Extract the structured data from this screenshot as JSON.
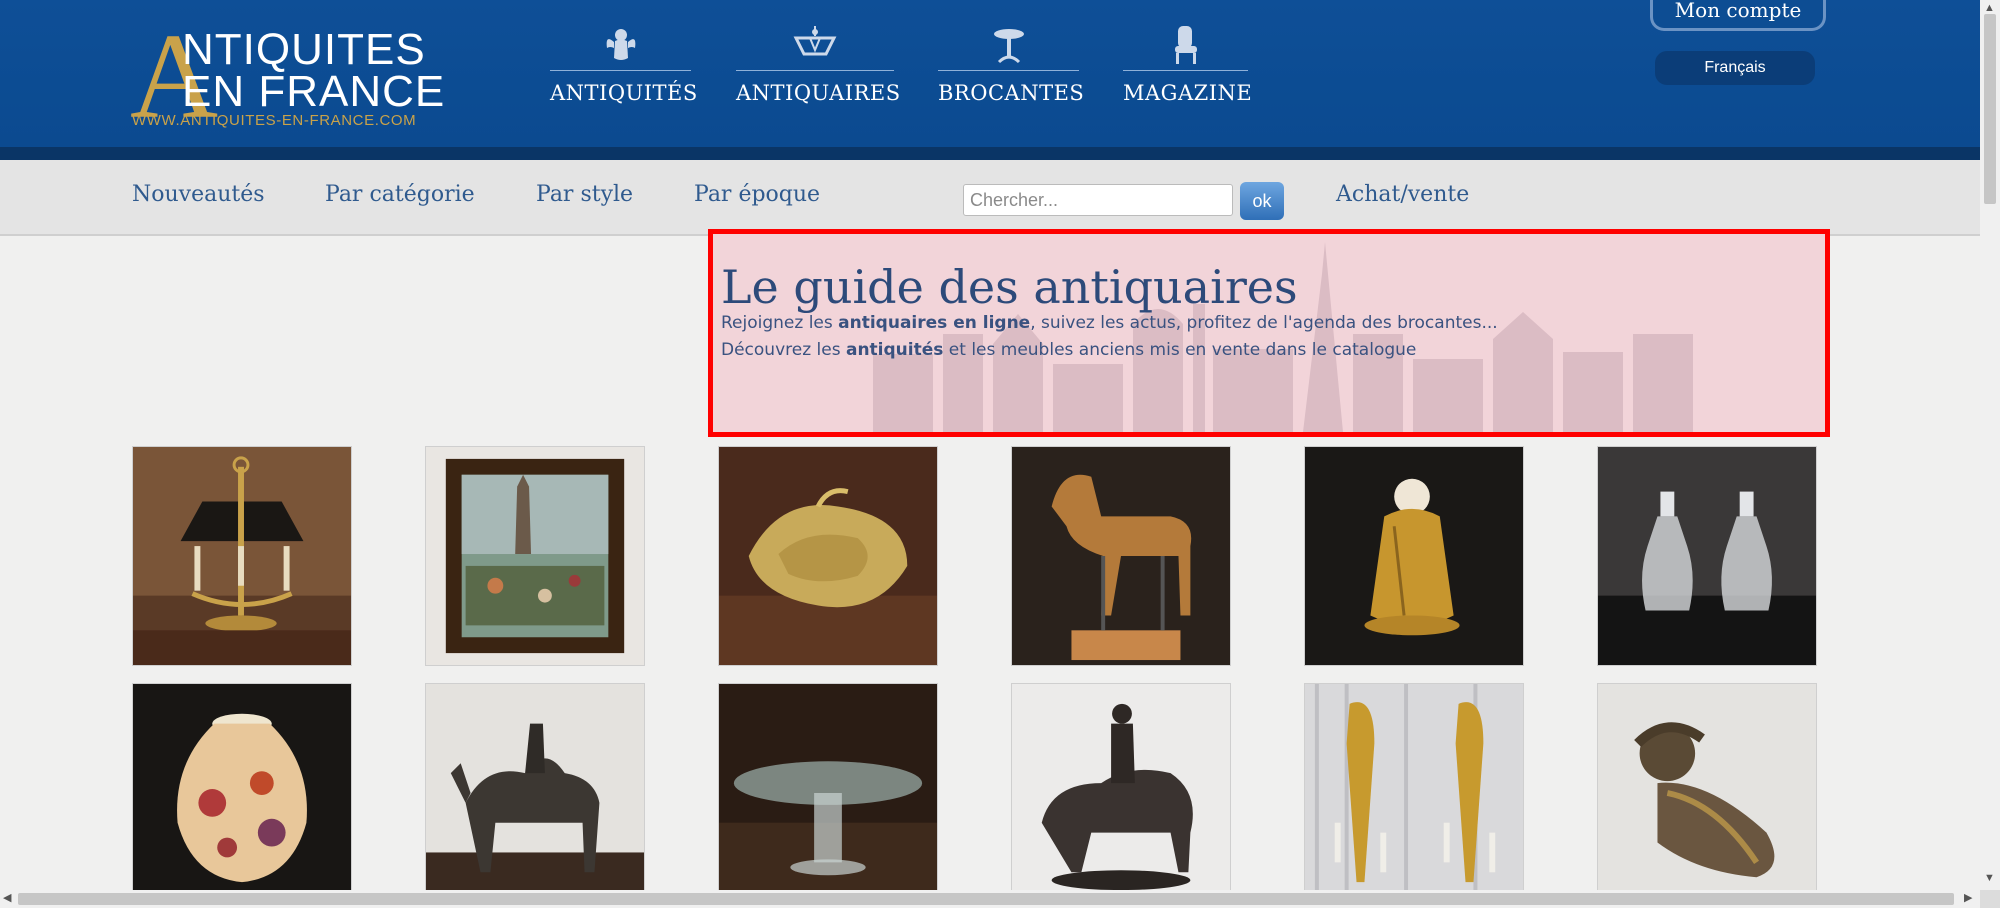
{
  "header": {
    "logo": {
      "big_letter": "A",
      "line1": "NTIQUITES",
      "line2": "EN FRANCE",
      "url": "WWW.ANTIQUITES-EN-FRANCE.COM"
    },
    "nav": [
      {
        "label": "ANTIQUITÉS",
        "icon": "cherub-icon"
      },
      {
        "label": "ANTIQUAIRES",
        "icon": "chandelier-icon"
      },
      {
        "label": "BROCANTES",
        "icon": "table-icon"
      },
      {
        "label": "MAGAZINE",
        "icon": "chair-icon"
      }
    ],
    "account_label": "Mon compte",
    "language": "Français"
  },
  "subnav": {
    "items": [
      "Nouveautés",
      "Par catégorie",
      "Par style",
      "Par époque"
    ],
    "search_placeholder": "Chercher...",
    "search_button": "ok",
    "achat_vente": "Achat/vente"
  },
  "banner": {
    "title": "Le guide des antiquaires",
    "line1_pre": "Rejoignez les ",
    "line1_bold": "antiquaires en ligne",
    "line1_post": ", suivez les actus, profitez de l'agenda des brocantes...",
    "line2_pre": "Découvrez les ",
    "line2_bold": "antiquités",
    "line2_post": " et les meubles anciens mis en vente dans le catalogue"
  },
  "products": [
    {
      "name": "bouillotte-lamp-image"
    },
    {
      "name": "market-painting-image"
    },
    {
      "name": "gilt-bronze-dish-image"
    },
    {
      "name": "wooden-horse-model-image"
    },
    {
      "name": "gilt-figure-image"
    },
    {
      "name": "glass-decanters-image"
    },
    {
      "name": "floral-vase-image"
    },
    {
      "name": "camel-rider-bronze-image"
    },
    {
      "name": "glass-table-image"
    },
    {
      "name": "horseman-bronze-image"
    },
    {
      "name": "wall-sconces-image"
    },
    {
      "name": "reclining-child-bronze-image"
    }
  ],
  "colors": {
    "header_bg": "#0e4f97",
    "gold": "#c9a24a",
    "link": "#2f5a8e",
    "banner_border": "#ff0000"
  }
}
